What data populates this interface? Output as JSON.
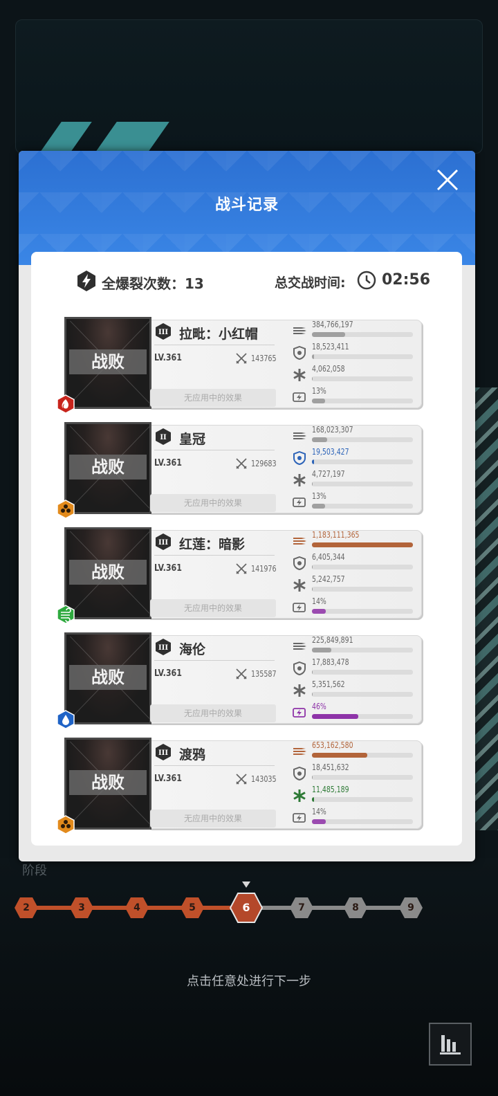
{
  "modal": {
    "title": "战斗记录",
    "total_burst_label": "全爆裂次数：13",
    "total_time_label": "总交战时间:",
    "total_time_value": "02:56"
  },
  "units": [
    {
      "name": "拉毗：小红帽",
      "level": "LV.361",
      "power": "143765",
      "status": "战败",
      "effect": "无应用中的效果",
      "rank": "III",
      "element": "fire",
      "stats": {
        "damage": {
          "value": "384,766,197",
          "ratio": 0.33,
          "color": "#a0a0a0"
        },
        "taken": {
          "value": "18,523,411",
          "ratio": 0.01,
          "color": "#a0a0a0"
        },
        "heal": {
          "value": "4,062,058",
          "ratio": 0.0,
          "color": "#a0a0a0"
        },
        "burst": {
          "value": "13%",
          "ratio": 0.13,
          "color": "#a0a0a0"
        }
      }
    },
    {
      "name": "皇冠",
      "level": "LV.361",
      "power": "129683",
      "status": "战败",
      "effect": "无应用中的效果",
      "rank": "II",
      "element": "iron",
      "stats": {
        "damage": {
          "value": "168,023,307",
          "ratio": 0.15,
          "color": "#a0a0a0"
        },
        "taken": {
          "value": "19,503,427",
          "ratio": 0.01,
          "color": "#2c63b8",
          "highlight": true
        },
        "heal": {
          "value": "4,727,197",
          "ratio": 0.0,
          "color": "#a0a0a0"
        },
        "burst": {
          "value": "13%",
          "ratio": 0.13,
          "color": "#a0a0a0"
        }
      }
    },
    {
      "name": "红莲：暗影",
      "level": "LV.361",
      "power": "141976",
      "status": "战败",
      "effect": "无应用中的效果",
      "rank": "III",
      "element": "wind",
      "stats": {
        "damage": {
          "value": "1,183,111,365",
          "ratio": 1.0,
          "color": "#b2643a",
          "highlight": true
        },
        "taken": {
          "value": "6,405,344",
          "ratio": 0.0,
          "color": "#a0a0a0"
        },
        "heal": {
          "value": "5,242,757",
          "ratio": 0.0,
          "color": "#a0a0a0"
        },
        "burst": {
          "value": "14%",
          "ratio": 0.14,
          "color": "#9b4bb0"
        }
      }
    },
    {
      "name": "海伦",
      "level": "LV.361",
      "power": "135587",
      "status": "战败",
      "effect": "无应用中的效果",
      "rank": "III",
      "element": "water",
      "stats": {
        "damage": {
          "value": "225,849,891",
          "ratio": 0.19,
          "color": "#a0a0a0"
        },
        "taken": {
          "value": "17,883,478",
          "ratio": 0.0,
          "color": "#a0a0a0"
        },
        "heal": {
          "value": "5,351,562",
          "ratio": 0.0,
          "color": "#a0a0a0"
        },
        "burst": {
          "value": "46%",
          "ratio": 0.46,
          "color": "#8e33a8",
          "highlight": true
        }
      }
    },
    {
      "name": "渡鸦",
      "level": "LV.361",
      "power": "143035",
      "status": "战败",
      "effect": "无应用中的效果",
      "rank": "III",
      "element": "iron",
      "stats": {
        "damage": {
          "value": "653,162,580",
          "ratio": 0.55,
          "color": "#b2643a",
          "highlight": true
        },
        "taken": {
          "value": "18,451,632",
          "ratio": 0.0,
          "color": "#a0a0a0"
        },
        "heal": {
          "value": "11,485,189",
          "ratio": 0.01,
          "color": "#2e7a36",
          "highlight": true
        },
        "burst": {
          "value": "14%",
          "ratio": 0.14,
          "color": "#9b4bb0"
        }
      }
    }
  ],
  "stages": [
    "2",
    "3",
    "4",
    "5",
    "6",
    "7",
    "8",
    "9"
  ],
  "current_stage": "6",
  "background": {
    "stage_label": "阶段"
  },
  "footer": {
    "hint": "点击任意处进行下一步"
  },
  "colors": {
    "header_blue": "#3a86e6",
    "accent_orange": "#c0502a",
    "inactive_grey": "#8a8a8a",
    "burst_purple": "#8e33a8"
  }
}
